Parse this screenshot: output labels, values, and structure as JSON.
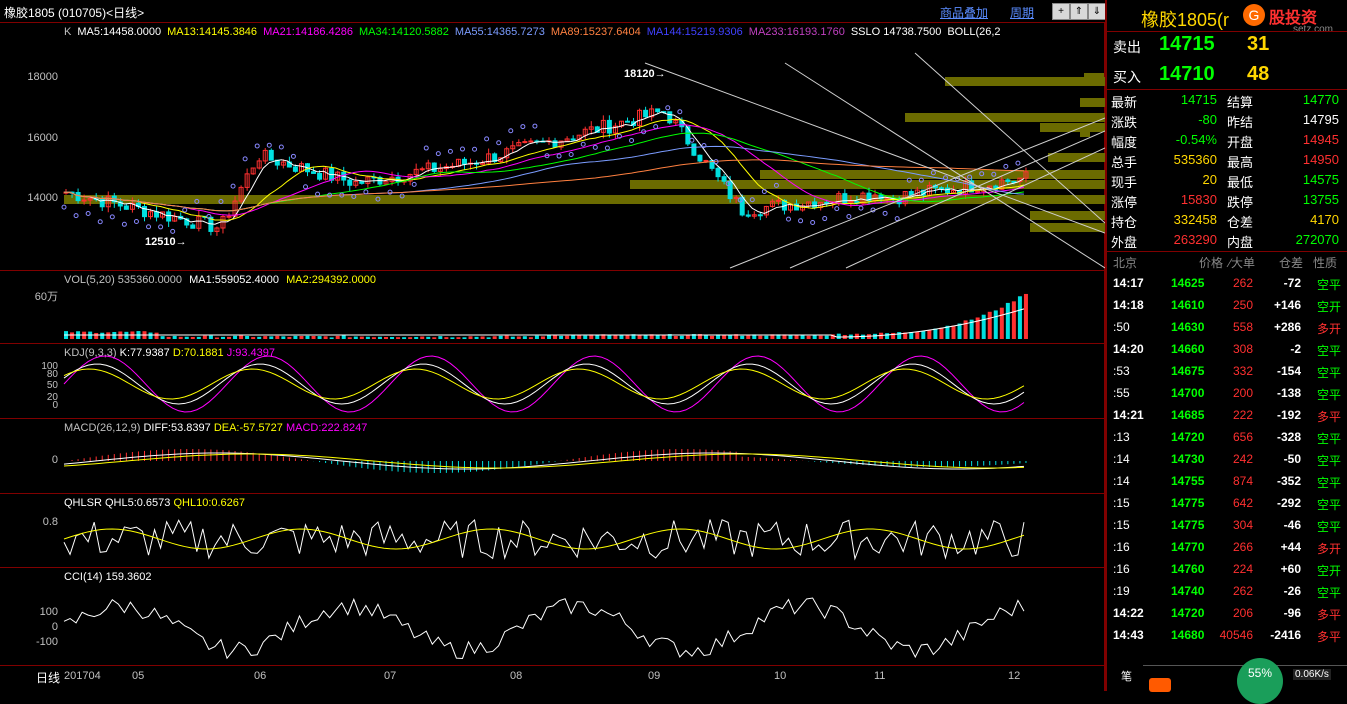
{
  "header": {
    "title": "橡胶1805 (010705)<日线>",
    "link_overlay": "商品叠加",
    "link_period": "周期"
  },
  "k_panel": {
    "indicators": [
      {
        "text": "K",
        "color": "#c0c0c0"
      },
      {
        "text": "MA5:14458.0000",
        "color": "#ffffff"
      },
      {
        "text": "MA13:14145.3846",
        "color": "#ffff00"
      },
      {
        "text": "MA21:14186.4286",
        "color": "#ff00ff"
      },
      {
        "text": "MA34:14120.5882",
        "color": "#00ff00"
      },
      {
        "text": "MA55:14365.7273",
        "color": "#7b9cff"
      },
      {
        "text": "MA89:15237.6404",
        "color": "#ff8040"
      },
      {
        "text": "MA144:15219.9306",
        "color": "#4040ff"
      },
      {
        "text": "MA233:16193.1760",
        "color": "#c040c0"
      },
      {
        "text": "SSLO  14738.7500",
        "color": "#ffffff"
      },
      {
        "text": "BOLL(26,2",
        "color": "#ffffff"
      }
    ],
    "y_labels": [
      "18000",
      "16000",
      "14000"
    ],
    "high_label": "18120→",
    "low_label": "12510→"
  },
  "vol_panel": {
    "label": "VOL(5,20) 535360.0000",
    "ma1": "MA1:559052.4000",
    "ma2": "MA2:294392.0000",
    "y_label": "60万"
  },
  "kdj_panel": {
    "label": "KDJ(9,3,3)",
    "k": "K:77.9387",
    "d": "D:70.1881",
    "j": "J:93.4397",
    "y_labels": [
      "100",
      "80",
      "50",
      "20",
      "0"
    ]
  },
  "macd_panel": {
    "label": "MACD(26,12,9)",
    "diff": "DIFF:53.8397",
    "dea": "DEA:-57.5727",
    "macd": "MACD:222.8247",
    "y_label": "0"
  },
  "qhlsr_panel": {
    "label": "QHLSR",
    "q5": "QHL5:0.6573",
    "q10": "QHL10:0.6267",
    "y_label": "0.8"
  },
  "cci_panel": {
    "label": "CCI(14)",
    "value": "159.3602",
    "y_labels": [
      "100",
      "0",
      "-100"
    ]
  },
  "x_axis": {
    "label": "日线",
    "ticks": [
      "201704",
      "05",
      "06",
      "07",
      "08",
      "09",
      "10",
      "11",
      "12"
    ]
  },
  "quote": {
    "name": "橡胶1805",
    "name_suffix": "(r",
    "logo_text": "股投资",
    "logo_sub": "setz.com",
    "sell_label": "卖出",
    "sell_price": "14715",
    "sell_vol": "31",
    "buy_label": "买入",
    "buy_price": "14710",
    "buy_vol": "48",
    "rows": [
      {
        "l1": "最新",
        "v1": "14715",
        "c1": "#00ff00",
        "l2": "结算",
        "v2": "14770",
        "c2": "#00ff00"
      },
      {
        "l1": "涨跌",
        "v1": "-80",
        "c1": "#00ff00",
        "l2": "昨结",
        "v2": "14795",
        "c2": "#ffffff"
      },
      {
        "l1": "幅度",
        "v1": "-0.54%",
        "c1": "#00ff00",
        "l2": "开盘",
        "v2": "14945",
        "c2": "#ff3030"
      },
      {
        "l1": "总手",
        "v1": "535360",
        "c1": "#ffd700",
        "l2": "最高",
        "v2": "14950",
        "c2": "#ff3030"
      },
      {
        "l1": "现手",
        "v1": "20",
        "c1": "#ffd700",
        "l2": "最低",
        "v2": "14575",
        "c2": "#00ff00"
      },
      {
        "l1": "涨停",
        "v1": "15830",
        "c1": "#ff3030",
        "l2": "跌停",
        "v2": "13755",
        "c2": "#00ff00"
      },
      {
        "l1": "持仓",
        "v1": "332458",
        "c1": "#ffd700",
        "l2": "仓差",
        "v2": "4170",
        "c2": "#ffd700"
      },
      {
        "l1": "外盘",
        "v1": "263290",
        "c1": "#ff3030",
        "l2": "内盘",
        "v2": "272070",
        "c2": "#00ff00"
      }
    ],
    "tick_header": {
      "place": "北京",
      "price": "价格",
      "big": "⁄大单",
      "diff": "仓差",
      "nature": "性质"
    },
    "ticks": [
      {
        "t": "14:17",
        "p": "14625",
        "v": "262",
        "d": "-72",
        "n": "空平",
        "tb": true
      },
      {
        "t": "14:18",
        "p": "14610",
        "v": "250",
        "d": "+146",
        "n": "空开",
        "tb": true
      },
      {
        "t": ":50",
        "p": "14630",
        "v": "558",
        "d": "+286",
        "n": "多开",
        "tb": false
      },
      {
        "t": "14:20",
        "p": "14660",
        "v": "308",
        "d": "-2",
        "n": "空平",
        "tb": true
      },
      {
        "t": ":53",
        "p": "14675",
        "v": "332",
        "d": "-154",
        "n": "空平",
        "tb": false
      },
      {
        "t": ":55",
        "p": "14700",
        "v": "200",
        "d": "-138",
        "n": "空平",
        "tb": false
      },
      {
        "t": "14:21",
        "p": "14685",
        "v": "222",
        "d": "-192",
        "n": "多平",
        "tb": true
      },
      {
        "t": ":13",
        "p": "14720",
        "v": "656",
        "d": "-328",
        "n": "空平",
        "tb": false
      },
      {
        "t": ":14",
        "p": "14730",
        "v": "242",
        "d": "-50",
        "n": "空平",
        "tb": false
      },
      {
        "t": ":14",
        "p": "14755",
        "v": "874",
        "d": "-352",
        "n": "空平",
        "tb": false
      },
      {
        "t": ":15",
        "p": "14775",
        "v": "642",
        "d": "-292",
        "n": "空平",
        "tb": false
      },
      {
        "t": ":15",
        "p": "14775",
        "v": "304",
        "d": "-46",
        "n": "空平",
        "tb": false
      },
      {
        "t": ":16",
        "p": "14770",
        "v": "266",
        "d": "+44",
        "n": "多开",
        "tb": false
      },
      {
        "t": ":16",
        "p": "14760",
        "v": "224",
        "d": "+60",
        "n": "空开",
        "tb": false
      },
      {
        "t": ":19",
        "p": "14740",
        "v": "262",
        "d": "-26",
        "n": "空平",
        "tb": false
      },
      {
        "t": "14:22",
        "p": "14720",
        "v": "206",
        "d": "-96",
        "n": "多平",
        "tb": true
      },
      {
        "t": "14:43",
        "p": "14680",
        "v": "40546",
        "d": "-2416",
        "n": "多平",
        "tb": true
      }
    ],
    "footer_label": "笔",
    "speed": "0.06K/s",
    "percent": "55%"
  }
}
